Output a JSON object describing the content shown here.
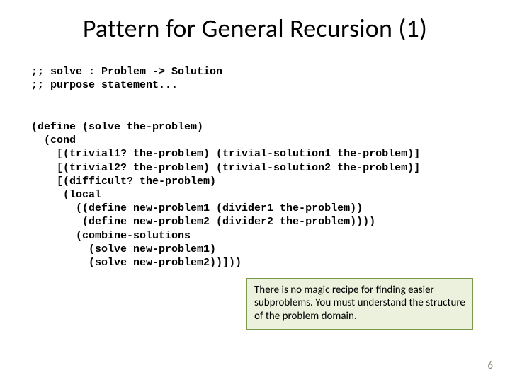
{
  "title": "Pattern for General Recursion (1)",
  "sig": ";; solve : Problem -> Solution\n;; purpose statement...",
  "code": "(define (solve the-problem)\n  (cond\n    [(trivial1? the-problem) (trivial-solution1 the-problem)]\n    [(trivial2? the-problem) (trivial-solution2 the-problem)]\n    [(difficult? the-problem)\n     (local\n       ((define new-problem1 (divider1 the-problem))\n        (define new-problem2 (divider2 the-problem))))\n       (combine-solutions\n         (solve new-problem1)\n         (solve new-problem2))]))",
  "callout": "There is no magic recipe for finding easier subproblems.  You must understand the structure of the problem domain.",
  "pagenum": "6"
}
